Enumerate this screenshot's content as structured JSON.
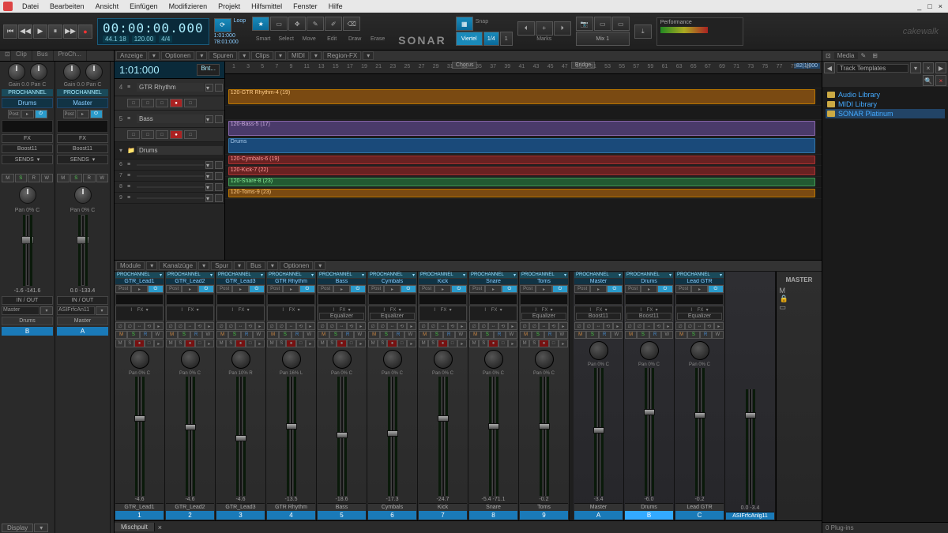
{
  "menubar": {
    "items": [
      "Datei",
      "Bearbeiten",
      "Ansicht",
      "Einfügen",
      "Modifizieren",
      "Projekt",
      "Hilfsmittel",
      "Fenster",
      "Hilfe"
    ]
  },
  "transport": {
    "time": "00:00:00.000",
    "meter": "44.1 18",
    "bpm": "120.00",
    "sig": "4/4"
  },
  "loop": {
    "label": "Loop",
    "in": "1:01:000",
    "out": "78:01:000"
  },
  "tools": [
    "Smart",
    "Select",
    "Move",
    "Edit",
    "Draw",
    "Erase"
  ],
  "snap": {
    "label": "Snap",
    "viertel": "Viertel",
    "v1": "1/4",
    "v2": "1"
  },
  "marks": "Marks",
  "mix": "Mix 1",
  "perf": "Performance",
  "logo": "SONAR",
  "brand": "cakewalk",
  "inspector": {
    "tabs": [
      "Clip",
      "Bus",
      "ProCh..."
    ],
    "strips": [
      {
        "pch": "PROCHANNEL",
        "name": "Drums",
        "gain": "Gain  0.0  Pan  C",
        "fx": "FX",
        "fxname": "Boost11",
        "post": "Post",
        "sends": "SENDS",
        "pan": "Pan  0% C",
        "peak": "-1.6  -141.6",
        "io": "IN / OUT",
        "in": "Master",
        "out": "",
        "dest": "Drums",
        "dest2": "B"
      },
      {
        "pch": "PROCHANNEL",
        "name": "Master",
        "gain": "Gain  0.0  Pan  C",
        "fx": "FX",
        "fxname": "Boost11",
        "post": "Post",
        "sends": "SENDS",
        "pan": "Pan  0% C",
        "peak": "0.0  -133.4",
        "io": "IN / OUT",
        "in": "ASIFrfcAn11",
        "out": "",
        "dest": "Master",
        "dest2": "A"
      }
    ],
    "display": "Display"
  },
  "trackview": {
    "toolbar": [
      "Anzeige",
      "Optionen",
      "Spuren",
      "Clips",
      "MIDI",
      "Region-FX"
    ],
    "time": "1:01:000",
    "bnt": "Bnt...",
    "tracks": [
      {
        "n": "4",
        "name": "GTR Rhythm",
        "type": "audio"
      },
      {
        "n": "5",
        "name": "Bass",
        "type": "audio"
      },
      {
        "n": "",
        "name": "Drums",
        "type": "folder"
      },
      {
        "n": "6",
        "name": "",
        "type": "sub"
      },
      {
        "n": "7",
        "name": "",
        "type": "sub"
      },
      {
        "n": "8",
        "name": "",
        "type": "sub"
      },
      {
        "n": "9",
        "name": "",
        "type": "sub"
      }
    ],
    "markers": [
      "Chorus",
      "Bridge"
    ],
    "clips": [
      {
        "label": "120-GTR Rhythm-4 (19)",
        "class": "orange"
      },
      {
        "label": "120-Bass-5 (17)",
        "class": "purple"
      },
      {
        "label": "Drums",
        "class": "blue"
      },
      {
        "label": "120-Cymbals-6 (19)",
        "class": "red"
      },
      {
        "label": "120-Kick-7 (22)",
        "class": "red"
      },
      {
        "label": "120-Snare-8 (23)",
        "class": "green"
      },
      {
        "label": "120-Toms-9 (23)",
        "class": "orange"
      }
    ],
    "rulerEnd": "82|1|000"
  },
  "console": {
    "toolbar": [
      "Module",
      "Kanalzüge",
      "Spur",
      "Bus",
      "Optionen"
    ],
    "tab": "Mischpult",
    "strips": [
      {
        "name": "GTR_Lead1",
        "eq": "",
        "ch": "1",
        "pan": "Pan  0% C",
        "val": "-4.6",
        "col": "#2a9"
      },
      {
        "name": "GTR_Lead2",
        "eq": "",
        "ch": "2",
        "pan": "Pan  0% C",
        "val": "-4.6",
        "col": "#2a9"
      },
      {
        "name": "GTR_Lead3",
        "eq": "",
        "ch": "3",
        "pan": "Pan  10% R",
        "val": "-4.6",
        "col": "#2a9"
      },
      {
        "name": "GTR Rhythm",
        "eq": "",
        "ch": "4",
        "pan": "Pan  16% L",
        "val": "-13.5",
        "col": "#b70"
      },
      {
        "name": "Bass",
        "eq": "Equalizer",
        "ch": "5",
        "pan": "Pan  0% C",
        "val": "-18.6",
        "col": "#86a"
      },
      {
        "name": "Cymbals",
        "eq": "Equalizer",
        "ch": "6",
        "pan": "Pan  0% C",
        "val": "-17.3",
        "col": "#a44"
      },
      {
        "name": "Kick",
        "eq": "",
        "ch": "7",
        "pan": "Pan  0% C",
        "val": "-24.7",
        "col": "#a44"
      },
      {
        "name": "Snare",
        "eq": "",
        "ch": "8",
        "pan": "Pan  0% C",
        "val": "-5.4  -71.1",
        "col": "#4a4"
      },
      {
        "name": "Toms",
        "eq": "Equalizer",
        "ch": "9",
        "pan": "Pan  0% C",
        "val": "-0.2",
        "col": "#b70"
      }
    ],
    "busses": [
      {
        "name": "Master",
        "eq": "Boost11",
        "ch": "A",
        "pan": "Pan  0% C",
        "val": "-3.4"
      },
      {
        "name": "Drums",
        "eq": "Boost11",
        "ch": "B",
        "pan": "Pan  0% C",
        "val": "-6.0",
        "sel": true
      },
      {
        "name": "Lead GTR",
        "eq": "Equalizer",
        "ch": "C",
        "pan": "Pan  0% C",
        "val": "-0.2"
      }
    ],
    "hw": {
      "name": "ASIFrfcAnlg11",
      "val": "0.0  -3.4"
    },
    "master": "MASTER",
    "pch": "PROCHANNEL",
    "post": "Post",
    "io": "I",
    "fx": "FX"
  },
  "browser": {
    "tab": "Media",
    "dropdown": "Track Templates",
    "items": [
      {
        "name": "Audio Library",
        "sel": false
      },
      {
        "name": "MIDI Library",
        "sel": false
      },
      {
        "name": "SONAR Platinum",
        "sel": true
      }
    ],
    "footer": "0 Plug-ins"
  }
}
